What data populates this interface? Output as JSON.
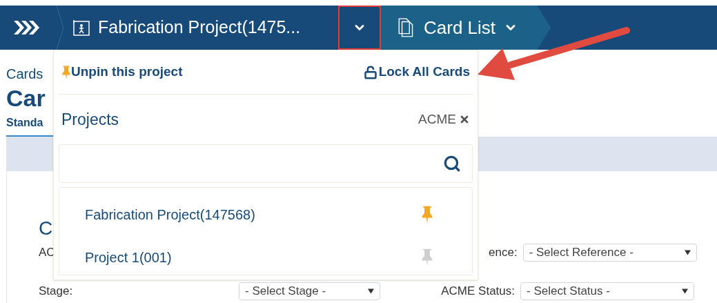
{
  "navbar": {
    "breadcrumbs": [
      {
        "kind": "project",
        "label": "Fabrication Project(1475..."
      },
      {
        "kind": "view",
        "label": "Card List"
      }
    ]
  },
  "page": {
    "breadcrumb": "Cards",
    "title": "Car",
    "tab": "Standa",
    "section_title": "C",
    "fields": [
      {
        "label": "AC"
      },
      {
        "label": "ence:",
        "value": "- Select Reference -"
      },
      {
        "label": "Stage:",
        "value": "- Select Stage -"
      },
      {
        "label": "ACME Status:",
        "value": "- Select Status -"
      }
    ]
  },
  "dropdown": {
    "unpin_label": "Unpin this project",
    "lock_label": "Lock All Cards",
    "section_title": "Projects",
    "filter_tag": "ACME",
    "projects": [
      {
        "name": "Fabrication Project(147568)",
        "pinned": true
      },
      {
        "name": "Project 1(001)",
        "pinned": false
      }
    ]
  }
}
